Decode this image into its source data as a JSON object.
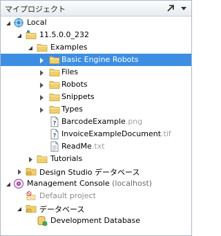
{
  "panel": {
    "title": "マイプロジェクト"
  },
  "tree": {
    "local": "Local",
    "version": "11.5.0.0_232",
    "examples": "Examples",
    "basic_engine_robots": "Basic Engine Robots",
    "files": "Files",
    "robots": "Robots",
    "snippets": "Snippets",
    "types": "Types",
    "barcode_name": "BarcodeExample",
    "barcode_ext": ".png",
    "invoice_name": "InvoiceExampleDocument",
    "invoice_ext": ".tif",
    "readme_name": "ReadMe",
    "readme_ext": ".txt",
    "tutorials": "Tutorials",
    "design_studio_db": "Design Studio データベース",
    "management_console": "Management Console",
    "mc_host": "(localhost)",
    "default_project": "Default project",
    "databases": "データベース",
    "development_database": "Development Database"
  },
  "colors": {
    "selection": "#3d8ee3",
    "folder": "#f2cf6e",
    "muted_text": "#8a8a8a"
  }
}
